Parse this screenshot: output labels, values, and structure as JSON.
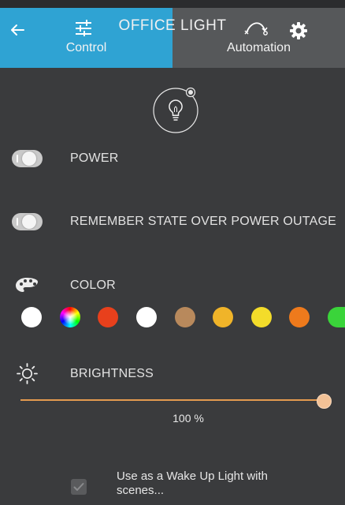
{
  "header": {
    "title": "OFFICE LIGHT",
    "tabs": [
      {
        "label": "Control",
        "icon": "sliders-icon",
        "active": true
      },
      {
        "label": "Automation",
        "icon": "automation-curve-icon",
        "active": false
      }
    ],
    "colors": {
      "active_tab": "#2fa3d3",
      "header_bg": "#56585a"
    }
  },
  "device": {
    "icon": "lightbulb-icon"
  },
  "power": {
    "label": "POWER",
    "on": false
  },
  "remember_state": {
    "label": "REMEMBER STATE OVER POWER OUTAGE",
    "on": false
  },
  "color": {
    "label": "COLOR",
    "icon": "palette-icon",
    "swatches": [
      "#ffffff",
      "rainbow",
      "#e8401c",
      "#ffffff",
      "#b8895c",
      "#f0b429",
      "#f3dc2a",
      "#ee7a1c",
      "#3ad43a"
    ]
  },
  "brightness": {
    "label": "BRIGHTNESS",
    "icon": "sun-icon",
    "value": 100,
    "value_text": "100 %",
    "accent": "#e49a4f"
  },
  "wake_up": {
    "label": "Use as a Wake Up Light with scenes...",
    "checked": true
  }
}
